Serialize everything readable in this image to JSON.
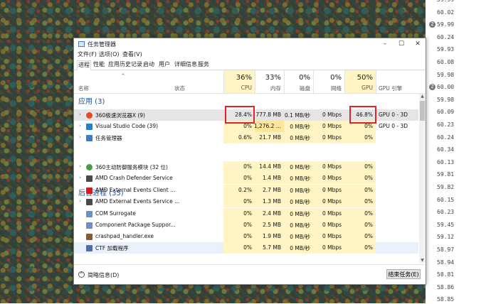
{
  "fps_panel": {
    "values": [
      "59.99",
      "60.02",
      "59.99",
      "60.24",
      "59.93",
      "60.08",
      "59.98",
      "60.00",
      "59.98",
      "60.09",
      "60.23",
      "60.24",
      "60.34",
      "60.13",
      "59.81",
      "59.82",
      "60.15",
      "60.23",
      "59.45",
      "59.12",
      "58.97",
      "58.94",
      "58.81",
      "58.86",
      "58.85"
    ],
    "badges": [
      {
        "row": 2,
        "label": "2"
      },
      {
        "row": 7,
        "label": "2"
      }
    ]
  },
  "window": {
    "title": "任务管理器",
    "controls": {
      "minimize": "–",
      "maximize": "☐",
      "close": "✕"
    },
    "menu": [
      "文件(F)",
      "选项(O)",
      "查看(V)"
    ],
    "tabs": [
      "进程",
      "性能",
      "应用历史记录",
      "启动",
      "用户",
      "详细信息",
      "服务"
    ],
    "active_tab": "进程",
    "columns": {
      "name": "名称",
      "status": "状态",
      "cpu": {
        "pct": "36%",
        "label": "CPU"
      },
      "mem": {
        "pct": "33%",
        "label": "内存"
      },
      "disk": {
        "pct": "0%",
        "label": "磁盘"
      },
      "net": {
        "pct": "0%",
        "label": "网络"
      },
      "gpu": {
        "pct": "50%",
        "label": "GPU"
      },
      "gpu_engine": "GPU 引擎"
    },
    "sections": {
      "apps": "应用 (3)",
      "background": "后台进程 (35)"
    },
    "rows": [
      {
        "name": "360极速浏览器X (9)",
        "cpu": "28.4%",
        "mem": "777.8 MB",
        "disk": "0.1 MB/秒",
        "net": "0 Mbps",
        "gpu": "46.8%",
        "gpu_engine": "GPU 0 - 3D",
        "icon": "browser-360-icon",
        "icon_color": "#e8492c",
        "expand": true
      },
      {
        "name": "Visual Studio Code (39)",
        "cpu": "0%",
        "mem": "1,276.2 ...",
        "disk": "0 MB/秒",
        "net": "0 Mbps",
        "gpu": "0%",
        "gpu_engine": "GPU 0 - 3D",
        "icon": "vscode-icon",
        "icon_color": "#1f7fd4",
        "expand": true
      },
      {
        "name": "任务管理器",
        "cpu": "0.6%",
        "mem": "21.7 MB",
        "disk": "0 MB/秒",
        "net": "0 Mbps",
        "gpu": "0%",
        "gpu_engine": "",
        "icon": "task-manager-icon",
        "icon_color": "#3a7dc9",
        "expand": true
      },
      {
        "name": "360主动防御服务模块 (32 位)",
        "cpu": "0%",
        "mem": "14.4 MB",
        "disk": "0 MB/秒",
        "net": "0 Mbps",
        "gpu": "0%",
        "gpu_engine": "",
        "icon": "shield-360-icon",
        "icon_color": "#43a047",
        "expand": true
      },
      {
        "name": "AMD Crash Defender Service",
        "cpu": "0%",
        "mem": "1.4 MB",
        "disk": "0 MB/秒",
        "net": "0 Mbps",
        "gpu": "0%",
        "gpu_engine": "",
        "icon": "service-icon",
        "icon_color": "#4a4a4a",
        "expand": true
      },
      {
        "name": "AMD External Events Client ...",
        "cpu": "0.2%",
        "mem": "2.7 MB",
        "disk": "0 MB/秒",
        "net": "0 Mbps",
        "gpu": "0%",
        "gpu_engine": "",
        "icon": "amd-icon",
        "icon_color": "#d71920",
        "expand": false
      },
      {
        "name": "AMD External Events Service ...",
        "cpu": "0%",
        "mem": "1.3 MB",
        "disk": "0 MB/秒",
        "net": "0 Mbps",
        "gpu": "0%",
        "gpu_engine": "",
        "icon": "service-icon",
        "icon_color": "#4a4a4a",
        "expand": true
      },
      {
        "name": "COM Surrogate",
        "cpu": "0%",
        "mem": "2.4 MB",
        "disk": "0 MB/秒",
        "net": "0 Mbps",
        "gpu": "0%",
        "gpu_engine": "",
        "icon": "app-window-icon",
        "icon_color": "#6b8fc7",
        "expand": false
      },
      {
        "name": "Component Package Suppor...",
        "cpu": "0%",
        "mem": "2.5 MB",
        "disk": "0 MB/秒",
        "net": "0 Mbps",
        "gpu": "0%",
        "gpu_engine": "",
        "icon": "app-window-icon",
        "icon_color": "#6b8fc7",
        "expand": false
      },
      {
        "name": "crashpad_handler.exe",
        "cpu": "0%",
        "mem": "1.9 MB",
        "disk": "0 MB/秒",
        "net": "0 Mbps",
        "gpu": "0%",
        "gpu_engine": "",
        "icon": "crashpad-icon",
        "icon_color": "#8b5a2b",
        "expand": false
      },
      {
        "name": "CTF 加载程序",
        "cpu": "0%",
        "mem": "5.7 MB",
        "disk": "0 MB/秒",
        "net": "0 Mbps",
        "gpu": "0%",
        "gpu_engine": "",
        "icon": "ctf-icon",
        "icon_color": "#4b6fae",
        "expand": false
      }
    ],
    "footer": {
      "fewer_details": "简略信息(D)",
      "end_task": "结束任务(E)"
    },
    "colors": {
      "heat_light": "#fff4c4",
      "heat_mid": "#ffe69a",
      "highlight_box": "#e2232b",
      "section_blue": "#1a4f9c"
    }
  }
}
